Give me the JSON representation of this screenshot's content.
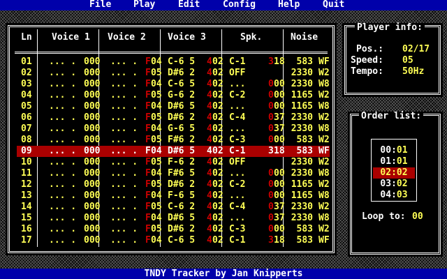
{
  "menu": [
    "File",
    "Play",
    "Edit",
    "Config",
    "Help",
    "Quit"
  ],
  "status": "TNDY Tracker by Jan Knipperts",
  "pattern": {
    "headers": [
      "Ln",
      "Voice 1",
      "Voice 2",
      "Voice 3",
      "Spk.",
      "Noise"
    ],
    "current_row_index": 8,
    "rows": [
      {
        "ln": "01",
        "v1": "... .",
        "v1n": "000",
        "v2": "... .",
        "v2f": "F",
        "v2n": "04",
        "v3": "C-6 5",
        "v3f": "4",
        "v3n": "02",
        "sp": "C-1",
        "spf": "3",
        "spn": "18",
        "nz": "583",
        "nzw": "WF"
      },
      {
        "ln": "02",
        "v1": "... .",
        "v1n": "000",
        "v2": "... .",
        "v2f": "F",
        "v2n": "05",
        "v3": "D#6 2",
        "v3f": "4",
        "v3n": "02",
        "sp": "OFF",
        "spf": "",
        "spn": "",
        "nz": "2330",
        "nzw": "W2"
      },
      {
        "ln": "03",
        "v1": "... .",
        "v1n": "000",
        "v2": "... .",
        "v2f": "F",
        "v2n": "04",
        "v3": "C-6 5",
        "v3f": "4",
        "v3n": "02",
        "sp": "...",
        "spf": "0",
        "spn": "00",
        "nz": "2330",
        "nzw": "W8"
      },
      {
        "ln": "04",
        "v1": "... .",
        "v1n": "000",
        "v2": "... .",
        "v2f": "F",
        "v2n": "05",
        "v3": "G-6 2",
        "v3f": "4",
        "v3n": "02",
        "sp": "C-2",
        "spf": "0",
        "spn": "00",
        "nz": "1165",
        "nzw": "W2"
      },
      {
        "ln": "05",
        "v1": "... .",
        "v1n": "000",
        "v2": "... .",
        "v2f": "F",
        "v2n": "04",
        "v3": "D#6 5",
        "v3f": "4",
        "v3n": "02",
        "sp": "...",
        "spf": "0",
        "spn": "00",
        "nz": "1165",
        "nzw": "W8"
      },
      {
        "ln": "06",
        "v1": "... .",
        "v1n": "000",
        "v2": "... .",
        "v2f": "F",
        "v2n": "05",
        "v3": "D#6 2",
        "v3f": "4",
        "v3n": "02",
        "sp": "C-4",
        "spf": "0",
        "spn": "37",
        "nz": "2330",
        "nzw": "W2"
      },
      {
        "ln": "07",
        "v1": "... .",
        "v1n": "000",
        "v2": "... .",
        "v2f": "F",
        "v2n": "04",
        "v3": "G-6 5",
        "v3f": "4",
        "v3n": "02",
        "sp": "...",
        "spf": "0",
        "spn": "37",
        "nz": "2330",
        "nzw": "W8"
      },
      {
        "ln": "08",
        "v1": "... .",
        "v1n": "000",
        "v2": "... .",
        "v2f": "F",
        "v2n": "05",
        "v3": "F#6 2",
        "v3f": "4",
        "v3n": "02",
        "sp": "C-3",
        "spf": "0",
        "spn": "00",
        "nz": "583",
        "nzw": "W2"
      },
      {
        "ln": "09",
        "v1": "... .",
        "v1n": "000",
        "v2": "... .",
        "v2f": "F",
        "v2n": "04",
        "v3": "D#6 5",
        "v3f": "4",
        "v3n": "02",
        "sp": "C-1",
        "spf": "3",
        "spn": "18",
        "nz": "583",
        "nzw": "WF"
      },
      {
        "ln": "10",
        "v1": "... .",
        "v1n": "000",
        "v2": "... .",
        "v2f": "F",
        "v2n": "05",
        "v3": "F-6 2",
        "v3f": "4",
        "v3n": "02",
        "sp": "OFF",
        "spf": "",
        "spn": "",
        "nz": "2330",
        "nzw": "W2"
      },
      {
        "ln": "11",
        "v1": "... .",
        "v1n": "000",
        "v2": "... .",
        "v2f": "F",
        "v2n": "04",
        "v3": "F#6 5",
        "v3f": "4",
        "v3n": "02",
        "sp": "...",
        "spf": "0",
        "spn": "00",
        "nz": "2330",
        "nzw": "W8"
      },
      {
        "ln": "12",
        "v1": "... .",
        "v1n": "000",
        "v2": "... .",
        "v2f": "F",
        "v2n": "05",
        "v3": "D#6 2",
        "v3f": "4",
        "v3n": "02",
        "sp": "C-2",
        "spf": "0",
        "spn": "00",
        "nz": "1165",
        "nzw": "W2"
      },
      {
        "ln": "13",
        "v1": "... .",
        "v1n": "000",
        "v2": "... .",
        "v2f": "F",
        "v2n": "04",
        "v3": "F-6 5",
        "v3f": "4",
        "v3n": "02",
        "sp": "...",
        "spf": "0",
        "spn": "00",
        "nz": "1165",
        "nzw": "W8"
      },
      {
        "ln": "14",
        "v1": "... .",
        "v1n": "000",
        "v2": "... .",
        "v2f": "F",
        "v2n": "05",
        "v3": "C-6 2",
        "v3f": "4",
        "v3n": "02",
        "sp": "C-4",
        "spf": "0",
        "spn": "37",
        "nz": "2330",
        "nzw": "W2"
      },
      {
        "ln": "15",
        "v1": "... .",
        "v1n": "000",
        "v2": "... .",
        "v2f": "F",
        "v2n": "04",
        "v3": "D#6 5",
        "v3f": "4",
        "v3n": "02",
        "sp": "...",
        "spf": "0",
        "spn": "37",
        "nz": "2330",
        "nzw": "W8"
      },
      {
        "ln": "16",
        "v1": "... .",
        "v1n": "000",
        "v2": "... .",
        "v2f": "F",
        "v2n": "05",
        "v3": "D#6 2",
        "v3f": "4",
        "v3n": "02",
        "sp": "C-3",
        "spf": "0",
        "spn": "00",
        "nz": "583",
        "nzw": "W2"
      },
      {
        "ln": "17",
        "v1": "... .",
        "v1n": "000",
        "v2": "... .",
        "v2f": "F",
        "v2n": "04",
        "v3": "C-6 5",
        "v3f": "4",
        "v3n": "02",
        "sp": "C-1",
        "spf": "3",
        "spn": "18",
        "nz": "583",
        "nzw": "WF"
      }
    ]
  },
  "player_info": {
    "title": "Player info:",
    "pos_label": "Pos.:",
    "pos_value": "02/17",
    "speed_label": "Speed:",
    "speed_value": "05",
    "tempo_label": "Tempo:",
    "tempo_value": "50Hz"
  },
  "order_list": {
    "title": "Order list:",
    "selected_index": 2,
    "items": [
      {
        "a": "00",
        "b": "01"
      },
      {
        "a": "01",
        "b": "01"
      },
      {
        "a": "02",
        "b": "02"
      },
      {
        "a": "03",
        "b": "02"
      },
      {
        "a": "04",
        "b": "03"
      }
    ],
    "loop_label": "Loop to:",
    "loop_value": "00"
  },
  "colors": {
    "blue": "#0000aa",
    "yellow": "#ffff55",
    "red": "#aa0000",
    "white": "#ffffff"
  }
}
